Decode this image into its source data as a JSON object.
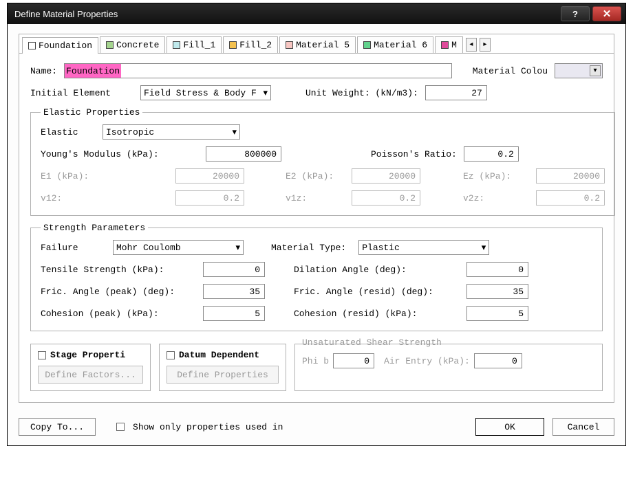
{
  "window": {
    "title": "Define Material Properties"
  },
  "tabs": [
    {
      "label": "Foundation",
      "color": "#ffffff"
    },
    {
      "label": "Concrete",
      "color": "#a5d48f"
    },
    {
      "label": "Fill_1",
      "color": "#bfe9ec"
    },
    {
      "label": "Fill_2",
      "color": "#f4c14e"
    },
    {
      "label": "Material 5",
      "color": "#f7c6c2"
    },
    {
      "label": "Material 6",
      "color": "#62d28d"
    },
    {
      "label": "M",
      "color": "#e04a9b"
    }
  ],
  "fields": {
    "name_label": "Name:",
    "name_value": "Foundation",
    "material_color_label": "Material Colou",
    "initial_element_label": "Initial Element",
    "initial_element_value": "Field Stress & Body F",
    "unit_weight_label": "Unit Weight:  (kN/m3):",
    "unit_weight_value": "27"
  },
  "elastic": {
    "legend": "Elastic Properties",
    "elastic_label": "Elastic",
    "elastic_value": "Isotropic",
    "ym_label": "Young's Modulus (kPa):",
    "ym_value": "800000",
    "pr_label": "Poisson's Ratio:",
    "pr_value": "0.2",
    "e1_label": "E1 (kPa):",
    "e1_value": "20000",
    "e2_label": "E2 (kPa):",
    "e2_value": "20000",
    "ez_label": "Ez (kPa):",
    "ez_value": "20000",
    "v12_label": "v12:",
    "v12_value": "0.2",
    "v1z_label": "v1z:",
    "v1z_value": "0.2",
    "v2z_label": "v2z:",
    "v2z_value": "0.2"
  },
  "strength": {
    "legend": "Strength Parameters",
    "failure_label": "Failure",
    "failure_value": "Mohr Coulomb",
    "mat_type_label": "Material Type:",
    "mat_type_value": "Plastic",
    "tensile_label": "Tensile Strength (kPa):",
    "tensile_value": "0",
    "dil_label": "Dilation Angle (deg):",
    "dil_value": "0",
    "fap_label": "Fric. Angle (peak) (deg):",
    "fap_value": "35",
    "far_label": "Fric. Angle (resid) (deg):",
    "far_value": "35",
    "cop_label": "Cohesion (peak) (kPa):",
    "cop_value": "5",
    "cor_label": "Cohesion (resid) (kPa):",
    "cor_value": "5"
  },
  "stage": {
    "chk_label": "Stage Properti",
    "btn_label": "Define Factors..."
  },
  "datum": {
    "chk_label": "Datum Dependent",
    "btn_label": "Define Properties"
  },
  "unsat": {
    "legend": "Unsaturated Shear Strength",
    "phib_label": "Phi b",
    "phib_value": "0",
    "air_label": "Air Entry (kPa):",
    "air_value": "0"
  },
  "footer": {
    "copy_label": "Copy To...",
    "show_only_label": "Show only properties used in",
    "ok_label": "OK",
    "cancel_label": "Cancel"
  }
}
